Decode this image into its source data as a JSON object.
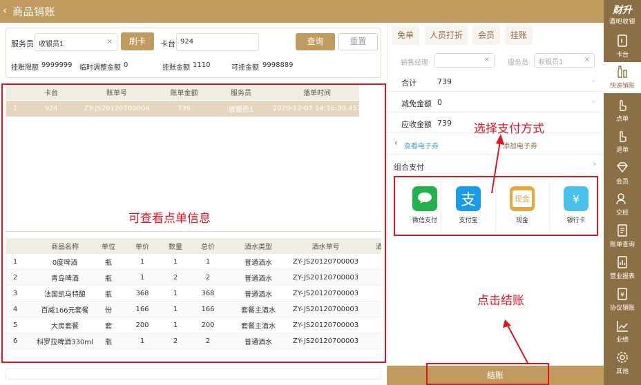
{
  "header": {
    "back_icon": "chevron-left-icon",
    "title": "商品销账"
  },
  "sidebar": {
    "brand": "财升",
    "brand_sub": "酒吧收银",
    "items": [
      {
        "label": "卡台",
        "icon": "card-icon"
      },
      {
        "label": "快速销账",
        "icon": "bottle-icon"
      },
      {
        "label": "点单",
        "icon": "hand-icon"
      },
      {
        "label": "退单",
        "icon": "return-icon"
      },
      {
        "label": "会员",
        "icon": "diamond-icon"
      },
      {
        "label": "交班",
        "icon": "people-icon"
      },
      {
        "label": "账单查询",
        "icon": "bill-icon"
      },
      {
        "label": "营业报表",
        "icon": "report-icon"
      },
      {
        "label": "协议销账",
        "icon": "yen-doc-icon"
      },
      {
        "label": "业绩",
        "icon": "chart-line-icon"
      },
      {
        "label": "其他",
        "icon": "gear-icon"
      }
    ]
  },
  "search": {
    "waiter_label": "服务员",
    "waiter_value": "收银员1",
    "clear": "×",
    "swipe_button": "刷卡",
    "table_label": "卡台",
    "table_value": "924",
    "query_button": "查询",
    "reset_button": "重置",
    "credit_limit_label": "挂账限额",
    "credit_limit_value": "9999999",
    "temp_adjust_label": "临时调整金额",
    "temp_adjust_value": "0",
    "credit_amount_label": "挂账金额",
    "credit_amount_value": "1110",
    "available_label": "可挂金额",
    "available_value": "9998889"
  },
  "bills": {
    "headers": [
      "卡台",
      "账单号",
      "账单金额",
      "服务员",
      "落单时间"
    ],
    "rows": [
      [
        "1",
        "924",
        "ZY-JS20120700004",
        "739",
        "收银员1",
        "2020-12-07 14:16:39.457"
      ]
    ]
  },
  "items": {
    "headers": [
      "商品名称",
      "单位",
      "单价",
      "数量",
      "总价",
      "酒水类型",
      "酒水单号",
      "酒"
    ],
    "rows": [
      [
        "1",
        "0度啤酒",
        "瓶",
        "1",
        "1",
        "1",
        "普通酒水",
        "ZY-JS20120700003"
      ],
      [
        "2",
        "青岛啤酒",
        "瓶",
        "1",
        "2",
        "2",
        "普通酒水",
        "ZY-JS20120700003"
      ],
      [
        "3",
        "法国凯马特酿",
        "瓶",
        "368",
        "1",
        "368",
        "普通酒水",
        "ZY-JS20120700003"
      ],
      [
        "4",
        "百威166元套餐",
        "份",
        "166",
        "1",
        "166",
        "套餐主酒水",
        "ZY-JS20120700003"
      ],
      [
        "5",
        "大房套餐",
        "套",
        "200",
        "1",
        "200",
        "套餐主酒水",
        "ZY-JS20120700003"
      ],
      [
        "6",
        "科罗拉啤酒330ml",
        "瓶",
        "1",
        "2",
        "2",
        "普通酒水",
        "ZY-JS20120700003"
      ]
    ]
  },
  "right": {
    "tabs": [
      "免单",
      "人员打折",
      "会员",
      "挂账"
    ],
    "sales_manager_label": "销售经理",
    "waiter_label": "服务员",
    "waiter_value": "收银员1",
    "total_label": "合计",
    "total_value": "739",
    "discount_label": "减免金额",
    "discount_value": "0",
    "receivable_label": "应收金额",
    "receivable_value": "739",
    "view_coupon": "查看电子券",
    "add_coupon": "添加电子券",
    "combo_pay": "组合支付",
    "payments": [
      {
        "label": "微信支付",
        "icon": "wechat-pay-icon",
        "color": "#22b14c",
        "glyph": "微信支付"
      },
      {
        "label": "支付宝",
        "icon": "alipay-icon",
        "color": "#1a9be8",
        "glyph": "支"
      },
      {
        "label": "现金",
        "icon": "cash-icon",
        "color": "#e7a93c",
        "glyph": "现金"
      },
      {
        "label": "银行卡",
        "icon": "bank-card-icon",
        "color": "#49c1e8",
        "glyph": "¥"
      }
    ],
    "checkout_button": "结账"
  },
  "annotations": {
    "view_orders": "可查看点单信息",
    "choose_payment": "选择支付方式",
    "click_checkout": "点击结账"
  },
  "colors": {
    "brand": "#c19a5e",
    "sidebar": "#8b6f45",
    "annotation": "#e0141e"
  }
}
